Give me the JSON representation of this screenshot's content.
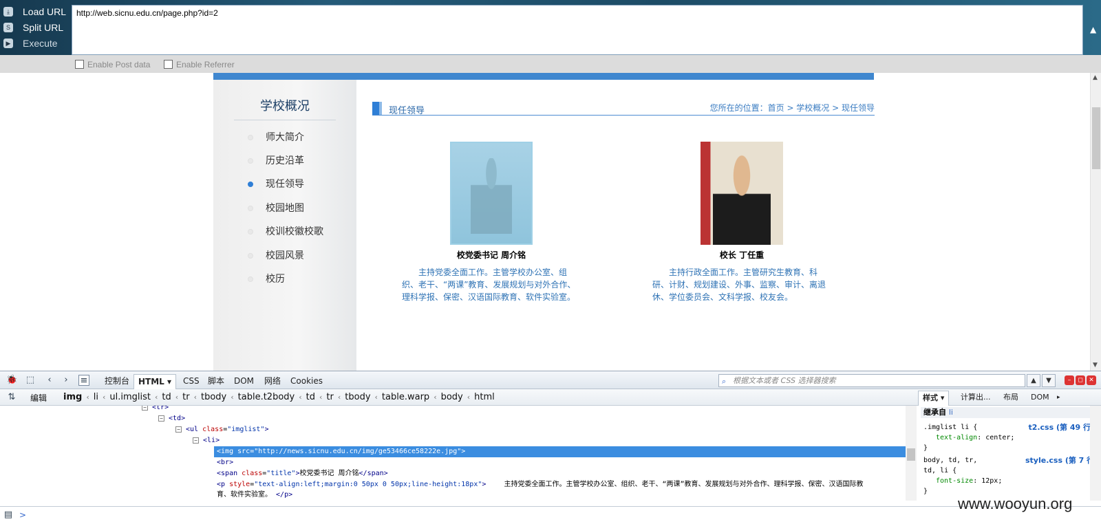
{
  "hackbar": {
    "load_url": "Load URL",
    "split_url": "Split URL",
    "execute": "Execute",
    "url_value": "http://web.sicnu.edu.cn/page.php?id=2",
    "enable_post": "Enable Post data",
    "enable_referrer": "Enable Referrer"
  },
  "page": {
    "sidebar": {
      "title": "学校概况",
      "items": [
        {
          "label": "师大简介",
          "active": false
        },
        {
          "label": "历史沿革",
          "active": false
        },
        {
          "label": "现任领导",
          "active": true
        },
        {
          "label": "校园地图",
          "active": false
        },
        {
          "label": "校训校徽校歌",
          "active": false
        },
        {
          "label": "校园风景",
          "active": false
        },
        {
          "label": "校历",
          "active": false
        }
      ]
    },
    "content_title": "现任领导",
    "breadcrumb": "您所在的位置：首页 > 学校概况 > 现任领导",
    "leaders": [
      {
        "name": "校党委书记 周介铭",
        "desc": "　　主持党委全面工作。主管学校办公室、组织、老干、“两课”教育、发展规划与对外合作、理科学报、保密、汉语国际教育、软件实验室。"
      },
      {
        "name": "校长 丁任重",
        "desc": "　　主持行政全面工作。主管研究生教育、科研、计财、规划建设、外事、监察、审计、离退休、学位委员会、文科学报、校友会。"
      }
    ]
  },
  "firebug": {
    "tabs": [
      "控制台",
      "HTML",
      "CSS",
      "脚本",
      "DOM",
      "网络",
      "Cookies"
    ],
    "active_tab": "HTML",
    "search_placeholder": "根据文本或者 CSS 选择器搜索",
    "edit_label": "编辑",
    "crumbs": [
      "img",
      "li",
      "ul.imglist",
      "td",
      "tr",
      "tbody",
      "table.t2body",
      "td",
      "tr",
      "tbody",
      "table.warp",
      "body",
      "html"
    ],
    "side_tabs": [
      "样式",
      "计算出...",
      "布局",
      "DOM"
    ],
    "inherited_label": "继承自",
    "inherited_el": "li",
    "html_lines": {
      "tr": "tr",
      "td": "td",
      "ul_tag": "ul",
      "ul_attr": "class",
      "ul_val": "imglist",
      "li": "li",
      "img_tag": "img",
      "img_attr": "src",
      "img_val": "http://news.sicnu.edu.cn/img/ge53466ce58222e.jpg",
      "br": "br",
      "span_tag": "span",
      "span_attr": "class",
      "span_val": "title",
      "span_text": "校党委书记 周介铭",
      "span_close": "span",
      "p_tag": "p",
      "p_attr": "style",
      "p_val": "text-align:left;margin:0 50px 0 50px;line-height:18px",
      "p_text": "　　主持党委全面工作。主管学校办公室、组织、老干、“两课”教育、发展规划与对外合作、理科学报、保密、汉语国际教",
      "p_text2": "育、软件实验室。",
      "p_close": "p"
    },
    "rules": [
      {
        "selector": ".imglist li {",
        "file": "t2.css (第 49 行)",
        "prop": "text-align",
        "value": "center;",
        "close": "}"
      },
      {
        "selector": "body, td, tr,",
        "selector2": "td, li {",
        "file": "style.css (第 7 行)",
        "prop": "font-size",
        "value": "12px;",
        "close": "}"
      }
    ]
  },
  "watermark": "www.wooyun.org"
}
